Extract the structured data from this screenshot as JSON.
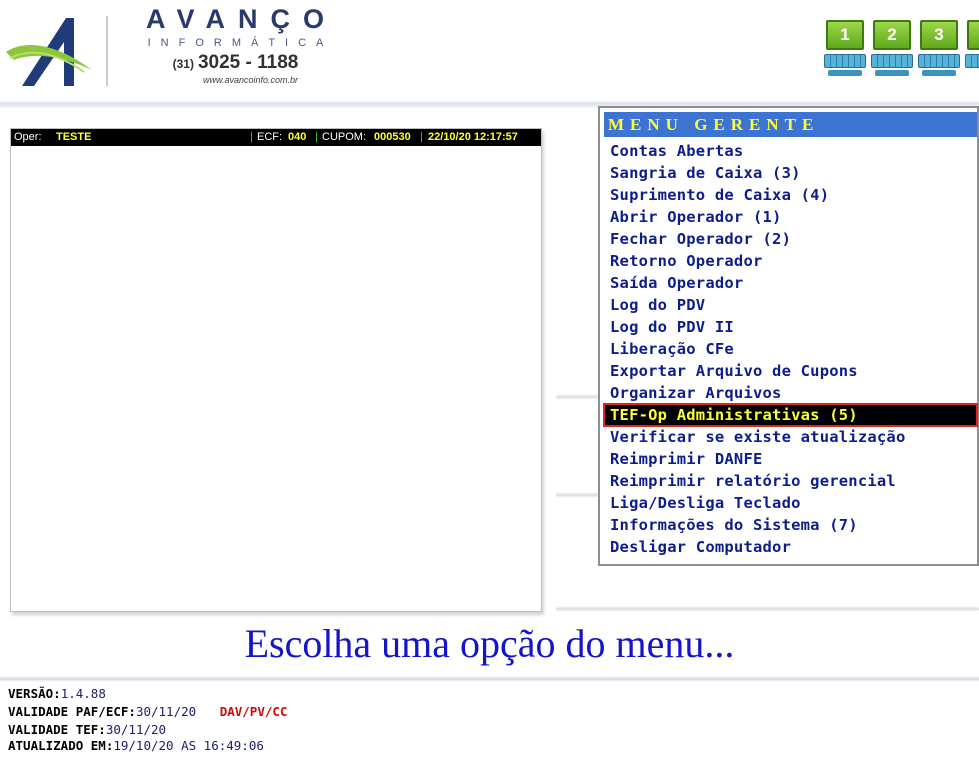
{
  "header": {
    "brand_name": "AVANÇO",
    "brand_sub": "INFORMÁTICA",
    "phone_ddd": "(31)",
    "phone_number": "3025 - 1188",
    "website": "www.avancoinfo.com.br",
    "workstations": [
      "1",
      "2",
      "3"
    ]
  },
  "operator_bar": {
    "oper_label": "Oper:",
    "oper_value": "TESTE",
    "ecf_label": "ECF:",
    "ecf_value": "040",
    "cupom_label": "CUPOM:",
    "cupom_value": "000530",
    "datetime": "22/10/20 12:17:57"
  },
  "menu": {
    "title": "MENU GERENTE",
    "selected_index": 12,
    "items": [
      {
        "label": "Contas Abertas"
      },
      {
        "label": "Sangria de Caixa (3)"
      },
      {
        "label": "Suprimento de Caixa (4)"
      },
      {
        "label": "Abrir Operador (1)"
      },
      {
        "label": "Fechar Operador (2)"
      },
      {
        "label": "Retorno Operador"
      },
      {
        "label": "Saída Operador"
      },
      {
        "label": "Log do PDV"
      },
      {
        "label": "Log do PDV II"
      },
      {
        "label": "Liberação CFe"
      },
      {
        "label": "Exportar Arquivo de Cupons"
      },
      {
        "label": "Organizar Arquivos"
      },
      {
        "label": "TEF-Op Administrativas (5)"
      },
      {
        "label": "Verificar se existe atualização"
      },
      {
        "label": "Reimprimir DANFE"
      },
      {
        "label": "Reimprimir relatório gerencial"
      },
      {
        "label": "Liga/Desliga Teclado"
      },
      {
        "label": "Informações do Sistema (7)"
      },
      {
        "label": "Desligar Computador"
      }
    ]
  },
  "prompt": "Escolha uma opção do menu...",
  "footer": {
    "versao_label": "VERSÃO:",
    "versao_value": "1.4.88",
    "paf_label": "VALIDADE PAF/ECF:",
    "paf_value": "30/11/20",
    "paf_flags": "DAV/PV/CC",
    "tef_label": "VALIDADE TEF:",
    "tef_value": "30/11/20",
    "atualizado_label": "ATUALIZADO EM:",
    "atualizado_value": "19/10/20 AS 16:49:06"
  },
  "colors": {
    "menu_title_bg": "#3d74d2",
    "menu_title_text": "#ffff39",
    "menu_item_text": "#0d1d8a",
    "selection_bg": "#000000",
    "selection_text": "#ffff2e",
    "selection_border": "#e0261b",
    "prompt_text": "#1414c8"
  }
}
